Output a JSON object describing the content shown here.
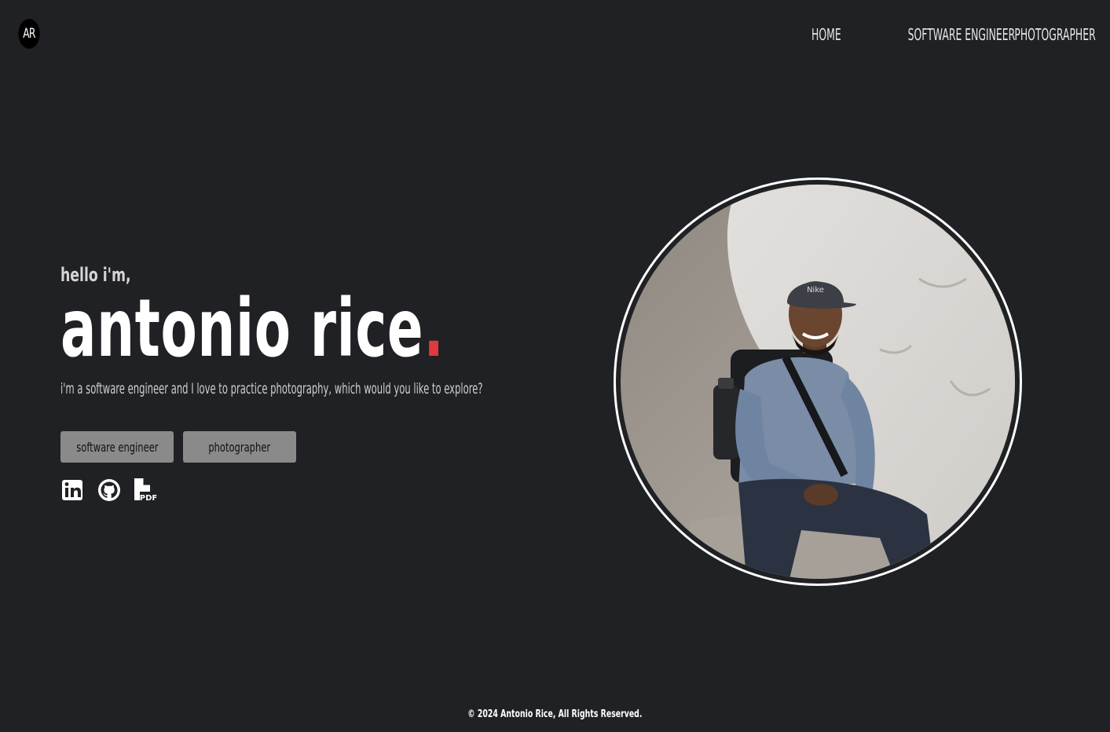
{
  "header": {
    "logo_text": "AR",
    "nav": [
      {
        "label": "HOME"
      },
      {
        "label": "SOFTWARE ENGINEER"
      },
      {
        "label": "PHOTOGRAPHER"
      }
    ]
  },
  "hero": {
    "greeting": "hello i'm,",
    "name": "antonio rice",
    "name_dot": ".",
    "tagline": "i'm a software engineer and I love to practice photography, which would you like to explore?",
    "buttons": {
      "software_engineer": "software engineer",
      "photographer": "photographer"
    },
    "socials": [
      {
        "icon": "linkedin-icon"
      },
      {
        "icon": "github-icon"
      },
      {
        "icon": "pdf-resume-icon",
        "badge": "PDF"
      }
    ],
    "photo_cap_text": "Nike"
  },
  "footer": {
    "copyright": "© 2024 Antonio Rice, All Rights Reserved."
  },
  "colors": {
    "background": "#202124",
    "accent_dot": "#e0393e",
    "button_bg": "#8a8a8a",
    "text": "#ffffff"
  }
}
